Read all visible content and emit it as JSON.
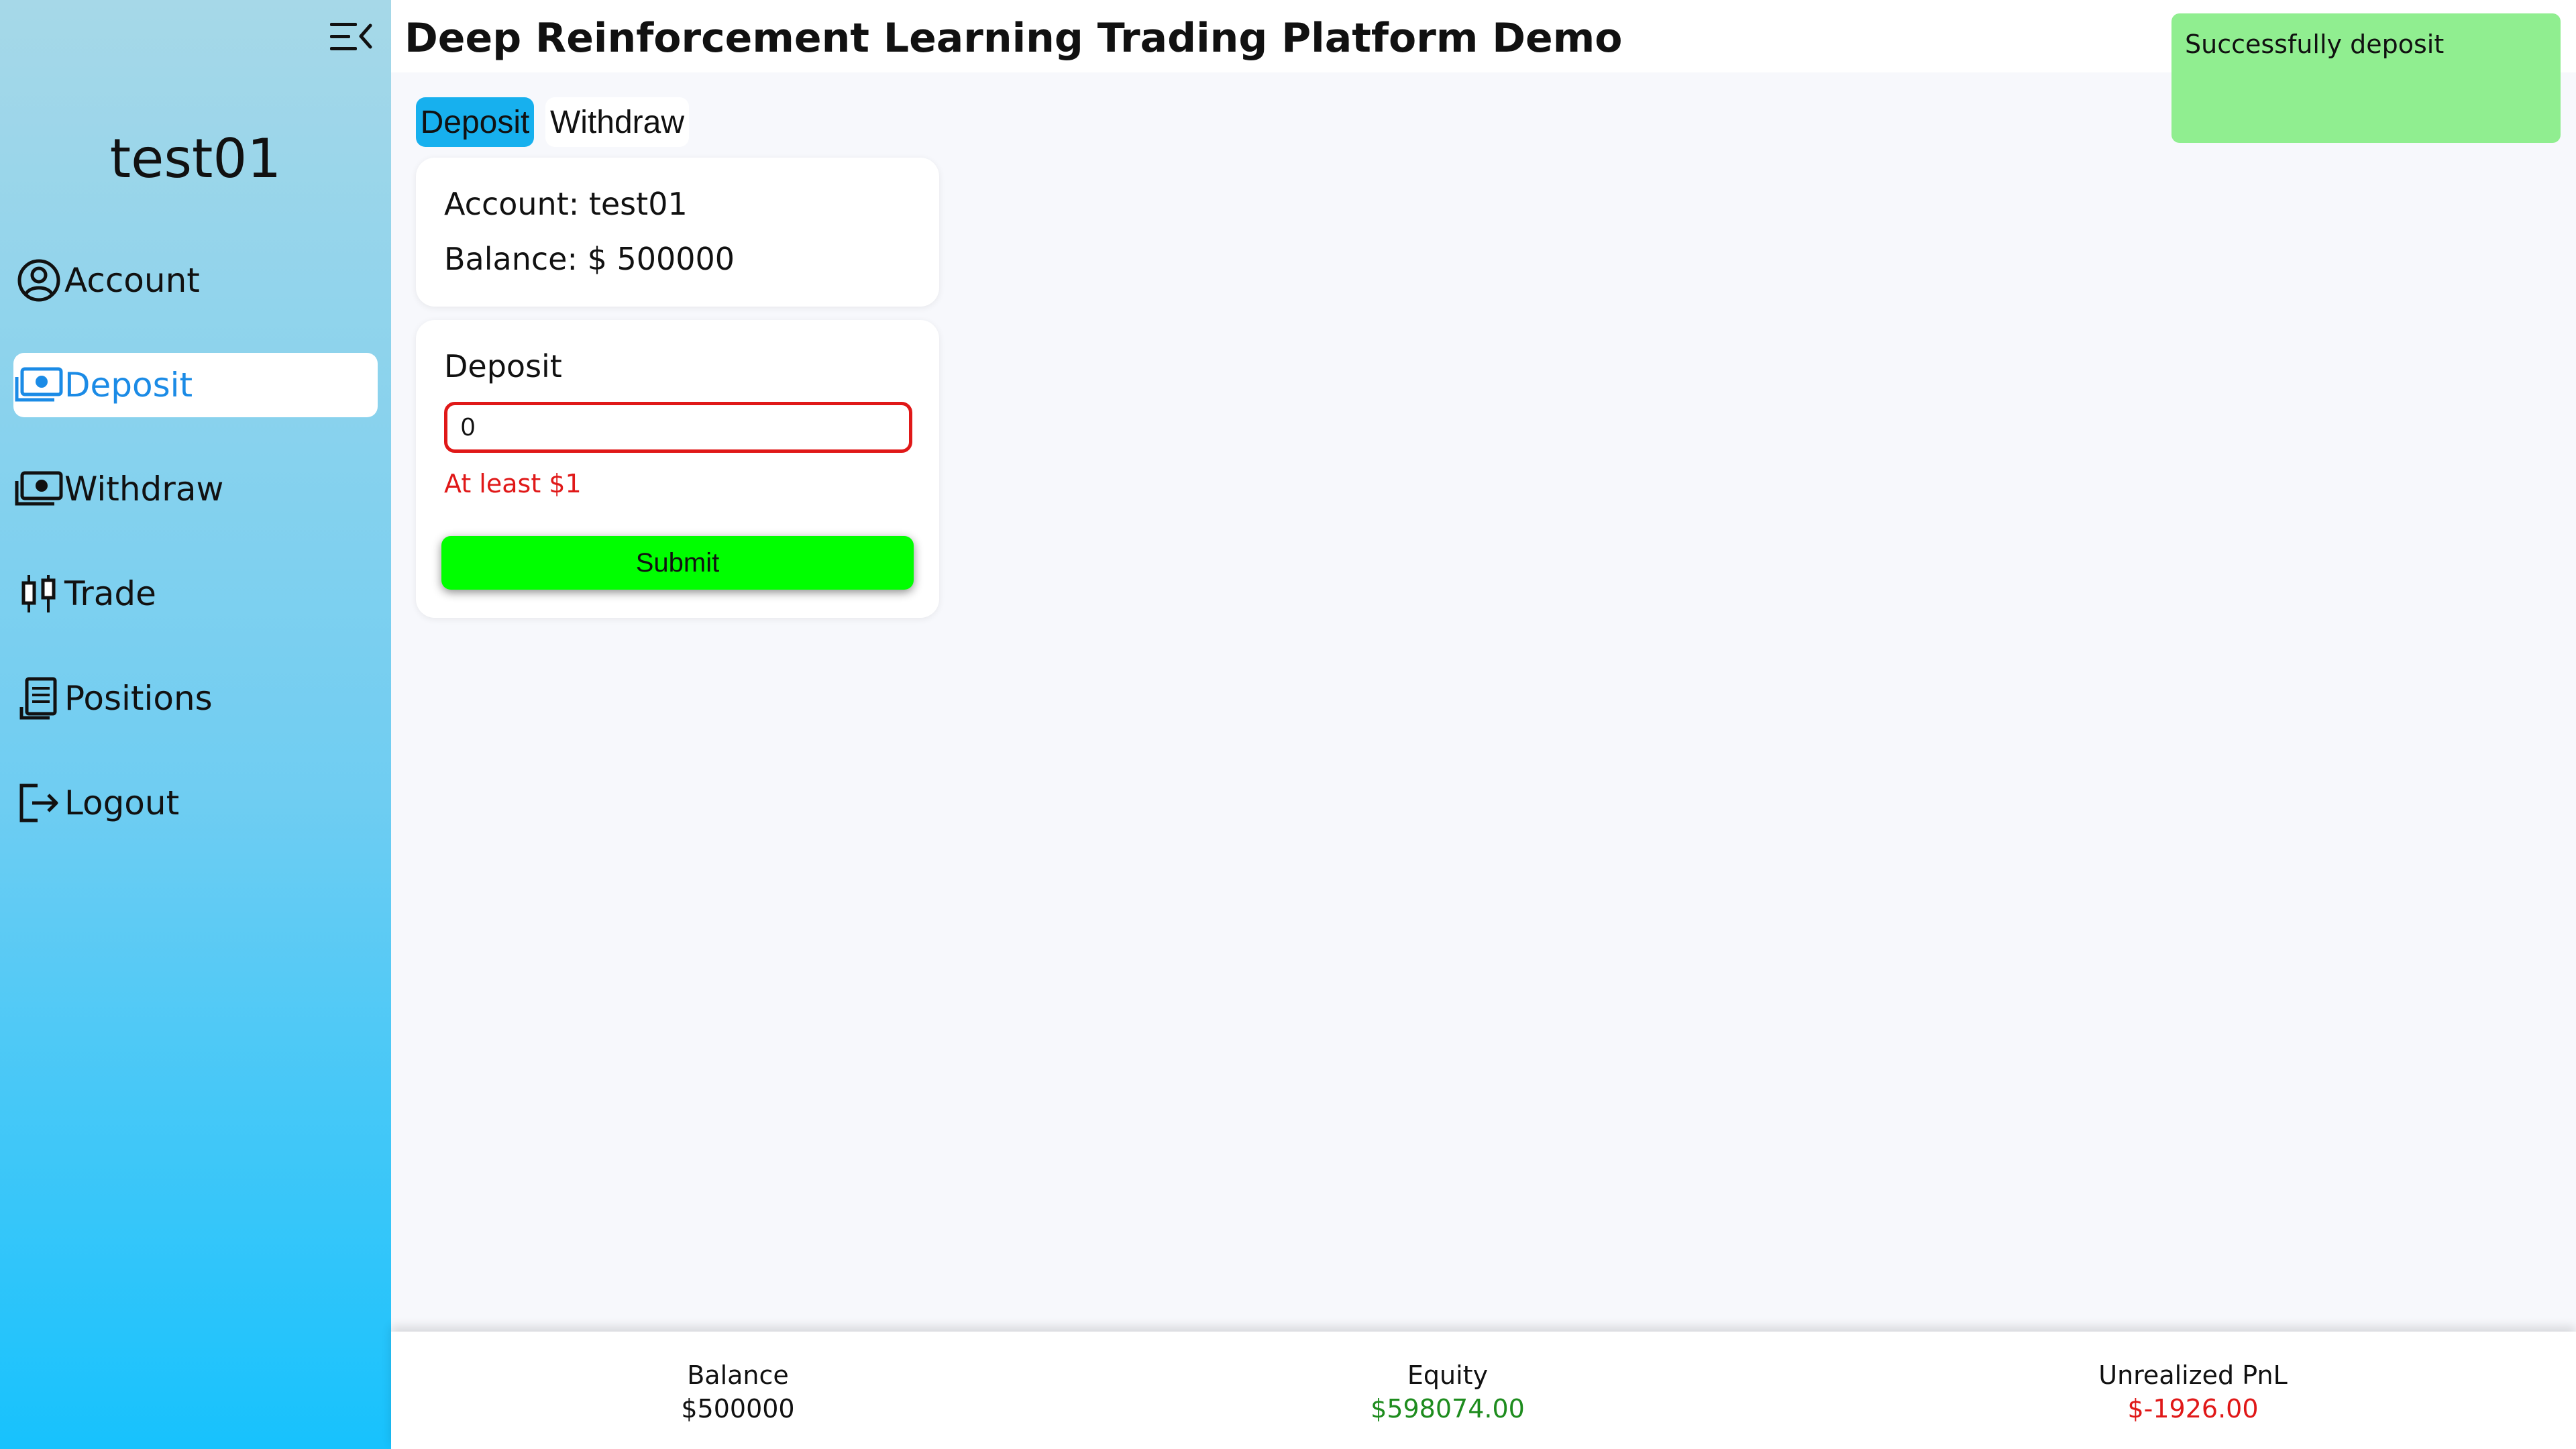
{
  "app": {
    "title": "Deep Reinforcement Learning Trading Platform Demo"
  },
  "sidebar": {
    "username": "test01",
    "items": [
      {
        "label": "Account",
        "icon": "user-circle-icon",
        "active": false
      },
      {
        "label": "Deposit",
        "icon": "money-icon",
        "active": true
      },
      {
        "label": "Withdraw",
        "icon": "money-icon",
        "active": false
      },
      {
        "label": "Trade",
        "icon": "candlestick-icon",
        "active": false
      },
      {
        "label": "Positions",
        "icon": "receipt-icon",
        "active": false
      },
      {
        "label": "Logout",
        "icon": "logout-icon",
        "active": false
      }
    ],
    "active_color": "#1b8be6"
  },
  "toast": {
    "message": "Successfully deposit",
    "color": "#90ee90"
  },
  "tabs": [
    {
      "label": "Deposit",
      "active": true
    },
    {
      "label": "Withdraw",
      "active": false
    }
  ],
  "account_card": {
    "account_line": "Account: test01",
    "balance_line": "Balance: $ 500000"
  },
  "deposit_form": {
    "title": "Deposit",
    "amount_value": "0",
    "error": "At least $1",
    "submit_label": "Submit",
    "submit_color": "#00ff00",
    "error_color": "#e01818"
  },
  "footer": {
    "stats": [
      {
        "label": "Balance",
        "value": "$500000",
        "color": "#111111"
      },
      {
        "label": "Equity",
        "value": "$598074.00",
        "color": "#1e8c1e"
      },
      {
        "label": "Unrealized PnL",
        "value": "$-1926.00",
        "color": "#e01818"
      }
    ]
  }
}
